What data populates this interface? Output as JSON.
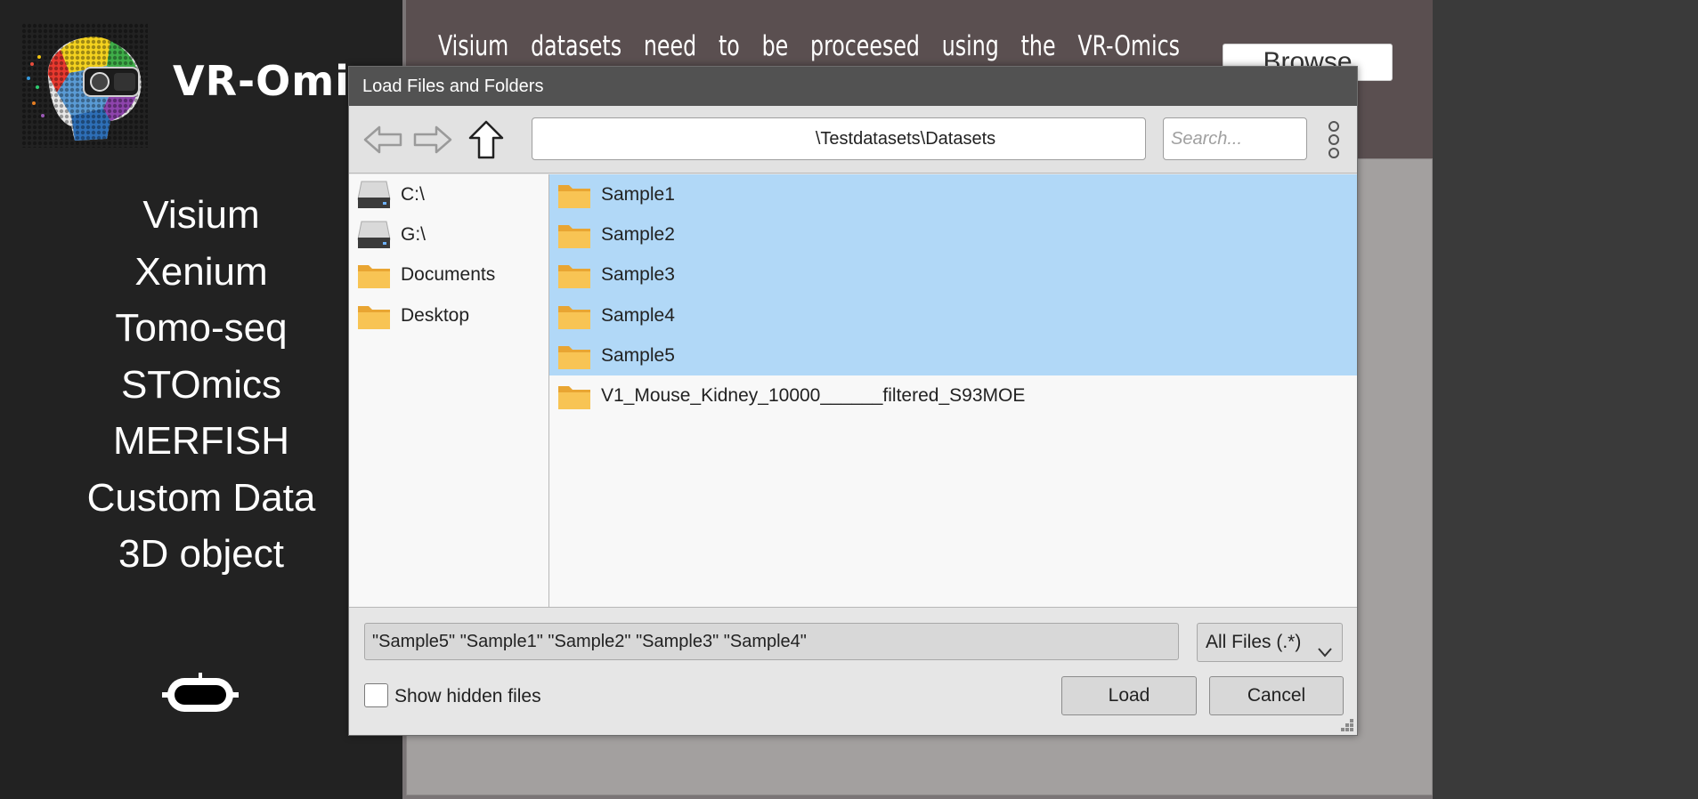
{
  "app": {
    "title": "VR-Omic",
    "logo": "brain-vr-headset-logo"
  },
  "sidebar": {
    "items": [
      {
        "label": "Visium"
      },
      {
        "label": "Xenium"
      },
      {
        "label": "Tomo-seq"
      },
      {
        "label": "STOmics"
      },
      {
        "label": "MERFISH"
      },
      {
        "label": "Custom Data"
      },
      {
        "label": "3D object"
      }
    ],
    "bottom_icon": "vr-headset-icon"
  },
  "main": {
    "info_text": "Visium datasets need to be proceesed using the VR-Omics",
    "browse_label": "Browse"
  },
  "dialog": {
    "title": "Load Files and Folders",
    "toolbar": {
      "back_icon": "back-arrow-icon",
      "forward_icon": "forward-arrow-icon",
      "up_icon": "up-arrow-icon",
      "path": "\\Testdatasets\\Datasets",
      "search_placeholder": "Search...",
      "more_icon": "more-vertical-icon"
    },
    "places": [
      {
        "label": "C:\\",
        "icon": "drive-icon"
      },
      {
        "label": "G:\\",
        "icon": "drive-icon"
      },
      {
        "label": "Documents",
        "icon": "folder-icon"
      },
      {
        "label": "Desktop",
        "icon": "folder-icon"
      }
    ],
    "files": [
      {
        "label": "Sample1",
        "icon": "folder-icon",
        "selected": true
      },
      {
        "label": "Sample2",
        "icon": "folder-icon",
        "selected": true
      },
      {
        "label": "Sample3",
        "icon": "folder-icon",
        "selected": true
      },
      {
        "label": "Sample4",
        "icon": "folder-icon",
        "selected": true
      },
      {
        "label": "Sample5",
        "icon": "folder-icon",
        "selected": true
      },
      {
        "label": "V1_Mouse_Kidney_10000______filtered_S93MOE",
        "icon": "folder-icon",
        "selected": false
      }
    ],
    "filename_value": "\"Sample5\" \"Sample1\" \"Sample2\" \"Sample3\" \"Sample4\"",
    "filter_value": "All Files (.*)",
    "show_hidden_label": "Show hidden files",
    "show_hidden_checked": false,
    "load_label": "Load",
    "cancel_label": "Cancel"
  },
  "colors": {
    "sidebar_bg": "#222222",
    "selection": "#b1d8f7",
    "folder": "#f7b941",
    "titlebar": "#525252"
  }
}
